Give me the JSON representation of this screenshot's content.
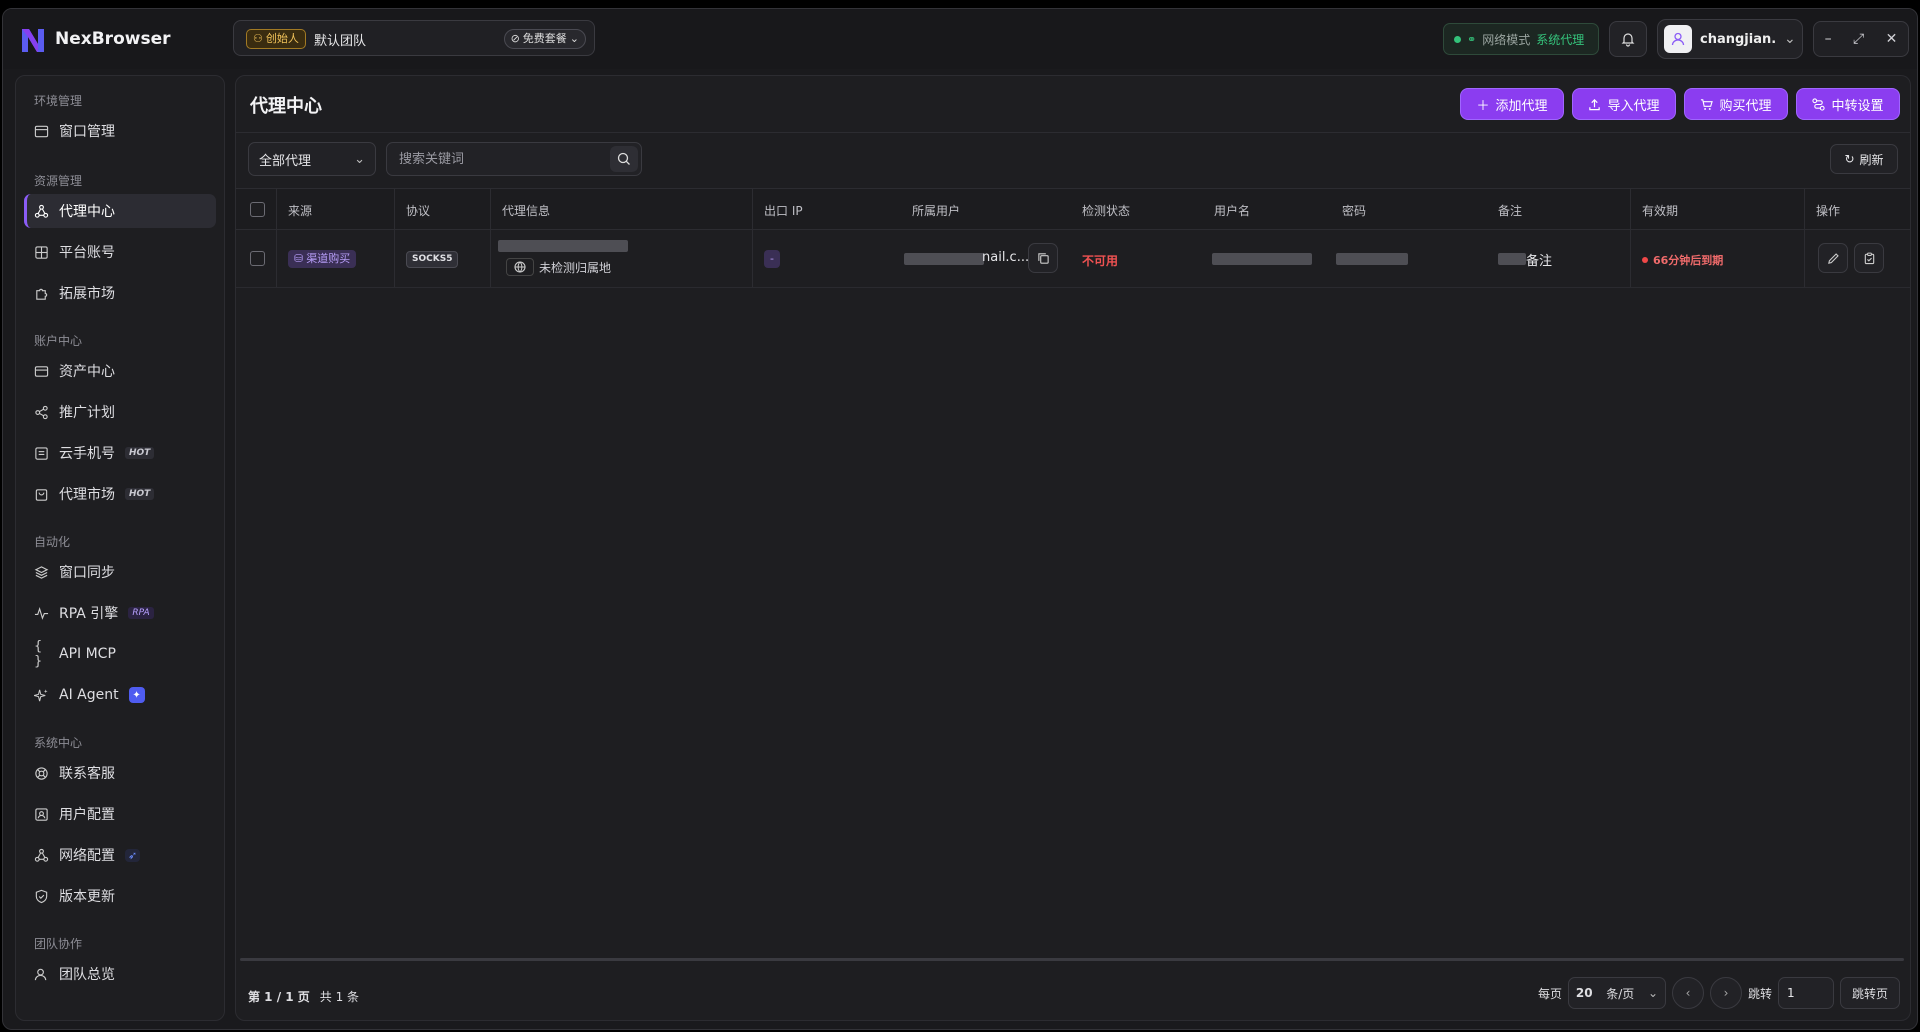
{
  "app": {
    "name": "NexBrowser"
  },
  "team": {
    "role_badge": "创始人",
    "name": "默认团队",
    "plan_badge": "免费套餐"
  },
  "network": {
    "label": "网络模式",
    "value": "系统代理"
  },
  "user": {
    "name": "changjian..."
  },
  "sidebar": {
    "groups": [
      {
        "label": "环境管理",
        "items": [
          {
            "label": "窗口管理",
            "icon": "window-icon"
          }
        ]
      },
      {
        "label": "资源管理",
        "items": [
          {
            "label": "代理中心",
            "icon": "proxy-icon",
            "active": true
          },
          {
            "label": "平台账号",
            "icon": "grid-icon"
          },
          {
            "label": "拓展市场",
            "icon": "puzzle-icon"
          }
        ]
      },
      {
        "label": "账户中心",
        "items": [
          {
            "label": "资产中心",
            "icon": "card-icon"
          },
          {
            "label": "推广计划",
            "icon": "share-icon"
          },
          {
            "label": "云手机号",
            "icon": "phone-icon",
            "tag": "HOT"
          },
          {
            "label": "代理市场",
            "icon": "bag-icon",
            "tag": "HOT"
          }
        ]
      },
      {
        "label": "自动化",
        "items": [
          {
            "label": "窗口同步",
            "icon": "layers-icon"
          },
          {
            "label": "RPA 引擎",
            "icon": "pulse-icon",
            "tag": "RPA"
          },
          {
            "label": "API MCP",
            "icon": "braces-icon"
          },
          {
            "label": "AI Agent",
            "icon": "sparkle-icon"
          }
        ]
      },
      {
        "label": "系统中心",
        "items": [
          {
            "label": "联系客服",
            "icon": "support-icon"
          },
          {
            "label": "用户配置",
            "icon": "user-config-icon"
          },
          {
            "label": "网络配置",
            "icon": "network-icon"
          },
          {
            "label": "版本更新",
            "icon": "shield-icon"
          }
        ]
      },
      {
        "label": "团队协作",
        "items": [
          {
            "label": "团队总览",
            "icon": "team-icon"
          }
        ]
      }
    ]
  },
  "main": {
    "title": "代理中心",
    "actions": {
      "add": "添加代理",
      "import": "导入代理",
      "buy": "购买代理",
      "relay": "中转设置"
    },
    "filter_value": "全部代理",
    "search_placeholder": "搜索关键词",
    "refresh": "刷新",
    "columns": [
      "来源",
      "协议",
      "代理信息",
      "出口 IP",
      "所属用户",
      "检测状态",
      "用户名",
      "密码",
      "备注",
      "有效期",
      "操作"
    ],
    "rows": [
      {
        "source": "渠道购买",
        "protocol": "SOCKS5",
        "geo": "未检测归属地",
        "exit_ip": "-",
        "user": "nail.c...",
        "status": "不可用",
        "remark": "备注",
        "expire": "66分钟后到期"
      }
    ]
  },
  "footer": {
    "page_info": "第 1 / 1 页",
    "total": "共 1 条",
    "per_page_label": "每页",
    "per_page_value": "20",
    "per_page_unit": "条/页",
    "jump_label": "跳转",
    "jump_value": "1",
    "jump_button": "跳转页"
  },
  "colors": {
    "accent": "#8b3df0",
    "danger": "#f05252",
    "success": "#35c47c"
  }
}
